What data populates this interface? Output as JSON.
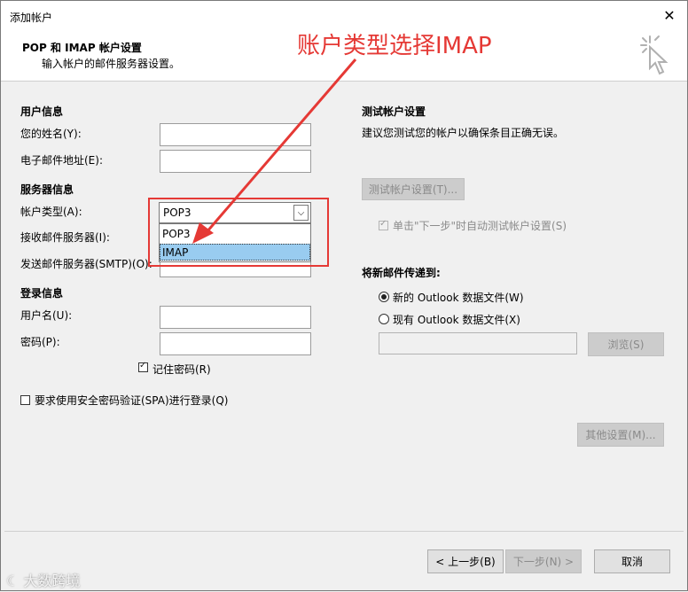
{
  "window": {
    "title": "添加帐户"
  },
  "header": {
    "title": "POP 和 IMAP 帐户设置",
    "subtitle": "输入帐户的邮件服务器设置。"
  },
  "annotation": {
    "text": "账户类型选择IMAP"
  },
  "user_info": {
    "heading": "用户信息",
    "name_label": "您的姓名(Y):",
    "email_label": "电子邮件地址(E):"
  },
  "server_info": {
    "heading": "服务器信息",
    "account_type_label": "帐户类型(A):",
    "account_type_value": "POP3",
    "account_type_options": [
      "POP3",
      "IMAP"
    ],
    "incoming_label": "接收邮件服务器(I):",
    "outgoing_label": "发送邮件服务器(SMTP)(O):"
  },
  "login_info": {
    "heading": "登录信息",
    "username_label": "用户名(U):",
    "password_label": "密码(P):",
    "remember_password_label": "记住密码(R)",
    "spa_label": "要求使用安全密码验证(SPA)进行登录(Q)"
  },
  "test_settings": {
    "heading": "测试帐户设置",
    "description": "建议您测试您的帐户以确保条目正确无误。",
    "test_button": "测试帐户设置(T)...",
    "auto_test_label": "单击\"下一步\"时自动测试帐户设置(S)"
  },
  "deliver": {
    "heading": "将新邮件传递到:",
    "new_file_label": "新的 Outlook 数据文件(W)",
    "existing_file_label": "现有 Outlook 数据文件(X)",
    "browse_button": "浏览(S)"
  },
  "more_settings_button": "其他设置(M)...",
  "footer": {
    "back_button": "< 上一步(B)",
    "next_button": "下一步(N) >",
    "cancel_button": "取消"
  },
  "watermark": "大数跨境",
  "colors": {
    "annotation_red": "#e53935",
    "selection_blue": "#99ccf0"
  }
}
